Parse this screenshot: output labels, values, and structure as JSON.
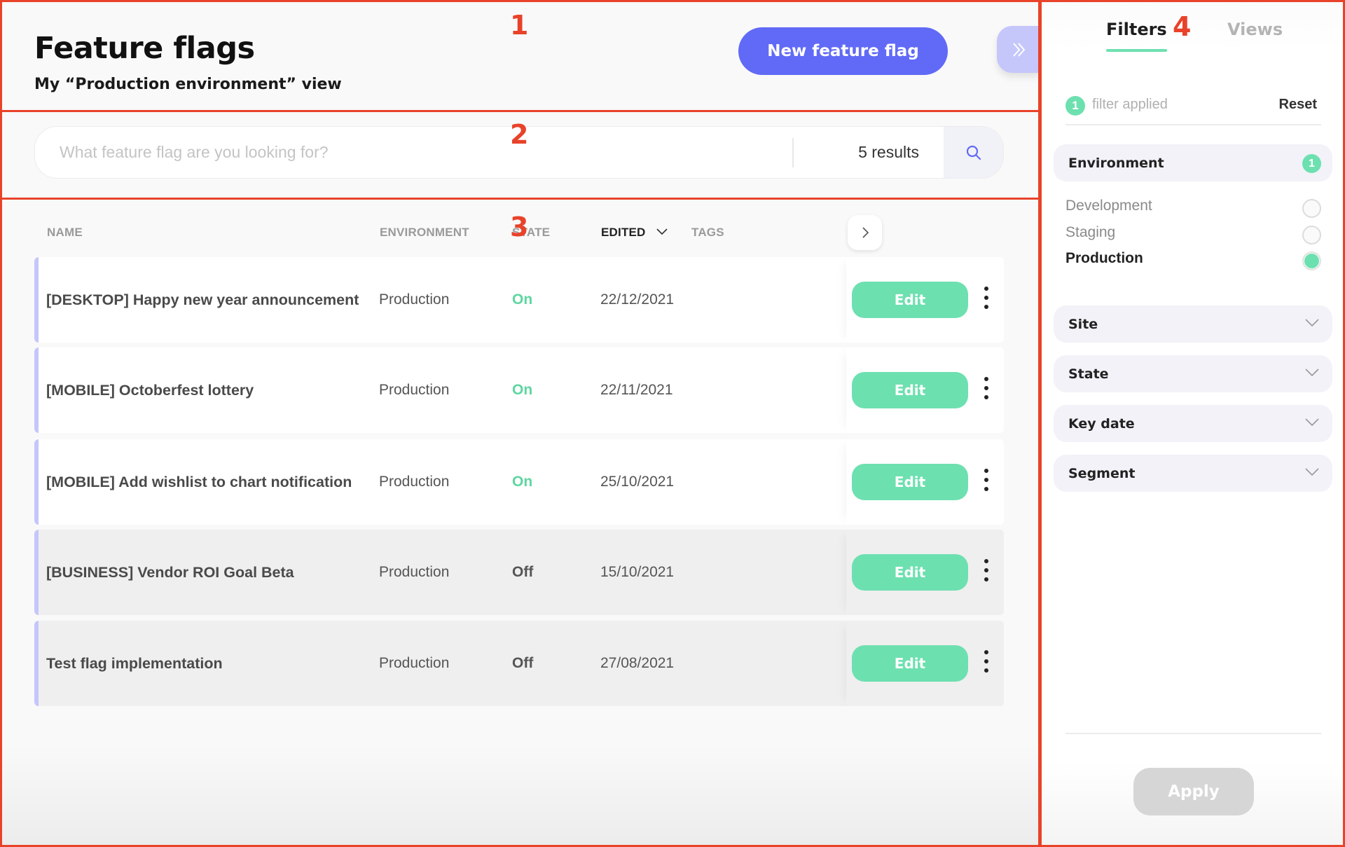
{
  "header": {
    "title": "Feature flags",
    "subtitle": "My “Production environment” view",
    "new_button_label": "New feature flag",
    "collapse_icon": "double-chevron-right-icon"
  },
  "search": {
    "placeholder": "What feature flag are you looking for?",
    "value": "",
    "results_label": "5 results",
    "icon": "search-icon"
  },
  "table": {
    "columns": {
      "name": "NAME",
      "environment": "ENVIRONMENT",
      "state": "STATE",
      "edited": "EDITED",
      "tags": "TAGS"
    },
    "sorted_by": "EDITED",
    "rows": [
      {
        "name": "[DESKTOP] Happy new year announcement",
        "environment": "Production",
        "state": "On",
        "edited": "22/12/2021",
        "tags": "",
        "action_label": "Edit"
      },
      {
        "name": "[MOBILE] Octoberfest lottery",
        "environment": "Production",
        "state": "On",
        "edited": "22/11/2021",
        "tags": "",
        "action_label": "Edit"
      },
      {
        "name": "[MOBILE] Add wishlist to chart notification",
        "environment": "Production",
        "state": "On",
        "edited": "25/10/2021",
        "tags": "",
        "action_label": "Edit"
      },
      {
        "name": "[BUSINESS] Vendor ROI Goal Beta",
        "environment": "Production",
        "state": "Off",
        "edited": "15/10/2021",
        "tags": "",
        "action_label": "Edit"
      },
      {
        "name": "Test flag implementation",
        "environment": "Production",
        "state": "Off",
        "edited": "27/08/2021",
        "tags": "",
        "action_label": "Edit"
      }
    ]
  },
  "filters_panel": {
    "tabs": [
      {
        "label": "Filters",
        "active": true
      },
      {
        "label": "Views",
        "active": false
      }
    ],
    "applied_count": "1",
    "applied_text": "filter applied",
    "reset_label": "Reset",
    "groups": [
      {
        "label": "Environment",
        "count": "1",
        "expanded": true,
        "options": [
          {
            "label": "Development",
            "selected": false
          },
          {
            "label": "Staging",
            "selected": false
          },
          {
            "label": "Production",
            "selected": true
          }
        ]
      },
      {
        "label": "Site",
        "expanded": false
      },
      {
        "label": "State",
        "expanded": false
      },
      {
        "label": "Key date",
        "expanded": false
      },
      {
        "label": "Segment",
        "expanded": false
      }
    ],
    "apply_label": "Apply"
  },
  "annotations": [
    "1",
    "2",
    "3",
    "4"
  ],
  "colors": {
    "primary": "#616af6",
    "primary_light": "#c5c6fa",
    "success": "#6de0b0",
    "state_on": "#5ed6a0",
    "annotation": "#e8432a",
    "disabled": "#d6d6d6"
  }
}
